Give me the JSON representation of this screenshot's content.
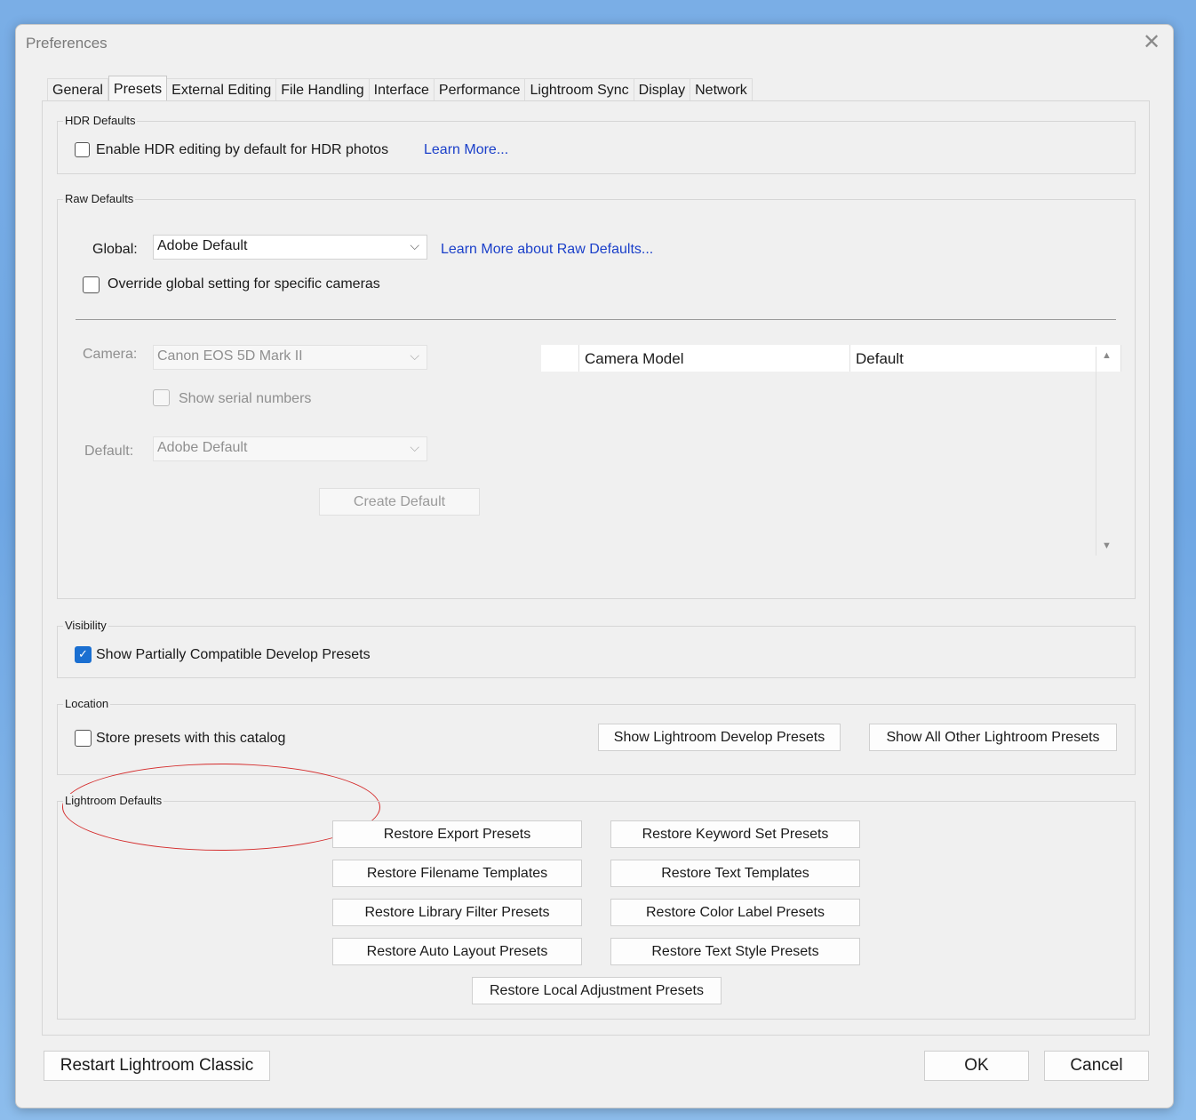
{
  "window": {
    "title": "Preferences"
  },
  "tabs": [
    "General",
    "Presets",
    "External Editing",
    "File Handling",
    "Interface",
    "Performance",
    "Lightroom Sync",
    "Display",
    "Network"
  ],
  "hdr": {
    "legend": "HDR Defaults",
    "checkbox_label": "Enable HDR editing by default for HDR photos",
    "checked": false,
    "learn_more": "Learn More..."
  },
  "raw": {
    "legend": "Raw Defaults",
    "global_label": "Global:",
    "global_value": "Adobe Default",
    "learn_more": "Learn More about Raw Defaults...",
    "override_label": "Override global setting for specific cameras",
    "override_checked": false,
    "camera_label": "Camera:",
    "camera_value": "Canon EOS 5D Mark II",
    "serial_label": "Show serial numbers",
    "default_label": "Default:",
    "default_value": "Adobe Default",
    "create_default": "Create Default",
    "table_headers": [
      "Camera Model",
      "Default"
    ]
  },
  "visibility": {
    "legend": "Visibility",
    "checkbox_label": "Show Partially Compatible Develop Presets",
    "checked": true
  },
  "location": {
    "legend": "Location",
    "checkbox_label": "Store presets with this catalog",
    "checked": false,
    "show_develop": "Show Lightroom Develop Presets",
    "show_other": "Show All Other Lightroom Presets"
  },
  "defaults": {
    "legend": "Lightroom Defaults",
    "buttons": [
      "Restore Export Presets",
      "Restore Keyword Set Presets",
      "Restore Filename Templates",
      "Restore Text Templates",
      "Restore Library Filter Presets",
      "Restore Color Label Presets",
      "Restore Auto Layout Presets",
      "Restore Text Style Presets",
      "Restore Local Adjustment Presets"
    ]
  },
  "footer": {
    "restart": "Restart Lightroom Classic",
    "ok": "OK",
    "cancel": "Cancel"
  },
  "icons": {
    "close": "close-icon",
    "chevron": "chevron-down-icon",
    "check": "check-icon"
  },
  "colors": {
    "accent": "#1a6fd1",
    "link": "#1a3fc9",
    "annotation": "#d42a2a"
  }
}
